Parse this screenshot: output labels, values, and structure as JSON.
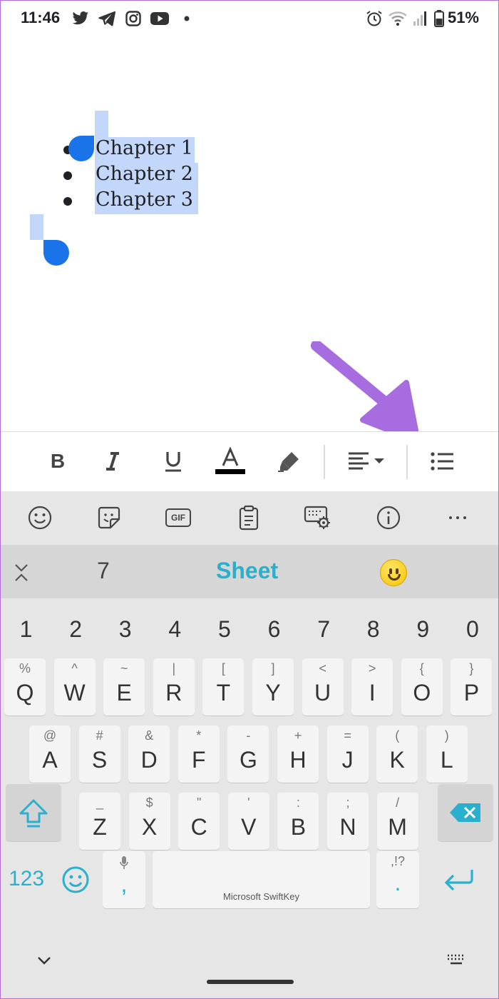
{
  "status_bar": {
    "time": "11:46",
    "battery_percent": "51%",
    "icons": [
      "twitter-icon",
      "telegram-icon",
      "instagram-icon",
      "youtube-icon",
      "dot-icon",
      "alarm-icon",
      "wifi-icon",
      "signal-icon",
      "battery-icon"
    ]
  },
  "document": {
    "list_items": [
      "Chapter 1",
      "Chapter 2",
      "Chapter 3"
    ]
  },
  "format_toolbar": {
    "bold": "B",
    "italic": "I",
    "underline": "U",
    "text_color": "A",
    "text_color_value": "#000000",
    "buttons": [
      "bold-button",
      "italic-button",
      "underline-button",
      "text-color-button",
      "highlight-button",
      "align-button",
      "bulleted-list-button"
    ]
  },
  "keyboard": {
    "toolbar_icons": [
      "emoji-icon",
      "sticker-icon",
      "gif-icon",
      "clipboard-icon",
      "settings-icon",
      "info-icon",
      "more-icon"
    ],
    "gif_label": "GIF",
    "suggestions": {
      "left": "7",
      "center": "Sheet",
      "right_emoji": "slightly-smiling-face"
    },
    "number_row": [
      "1",
      "2",
      "3",
      "4",
      "5",
      "6",
      "7",
      "8",
      "9",
      "0"
    ],
    "row1": [
      {
        "key": "Q",
        "sec": "%"
      },
      {
        "key": "W",
        "sec": "^"
      },
      {
        "key": "E",
        "sec": "~"
      },
      {
        "key": "R",
        "sec": "|"
      },
      {
        "key": "T",
        "sec": "["
      },
      {
        "key": "Y",
        "sec": "]"
      },
      {
        "key": "U",
        "sec": "<"
      },
      {
        "key": "I",
        "sec": ">"
      },
      {
        "key": "O",
        "sec": "{"
      },
      {
        "key": "P",
        "sec": "}"
      }
    ],
    "row2": [
      {
        "key": "A",
        "sec": "@"
      },
      {
        "key": "S",
        "sec": "#"
      },
      {
        "key": "D",
        "sec": "&"
      },
      {
        "key": "F",
        "sec": "*"
      },
      {
        "key": "G",
        "sec": "-"
      },
      {
        "key": "H",
        "sec": "+"
      },
      {
        "key": "J",
        "sec": "="
      },
      {
        "key": "K",
        "sec": "("
      },
      {
        "key": "L",
        "sec": ")"
      }
    ],
    "row3": [
      {
        "key": "Z",
        "sec": "_"
      },
      {
        "key": "X",
        "sec": "$"
      },
      {
        "key": "C",
        "sec": "\""
      },
      {
        "key": "V",
        "sec": "'"
      },
      {
        "key": "B",
        "sec": ":"
      },
      {
        "key": "N",
        "sec": ";"
      },
      {
        "key": "M",
        "sec": "/"
      }
    ],
    "numbers_key": "123",
    "comma": ",",
    "space_label": "Microsoft SwiftKey",
    "period": ".",
    "period_alt": ",!?",
    "accent_color": "#2ab0ce"
  }
}
